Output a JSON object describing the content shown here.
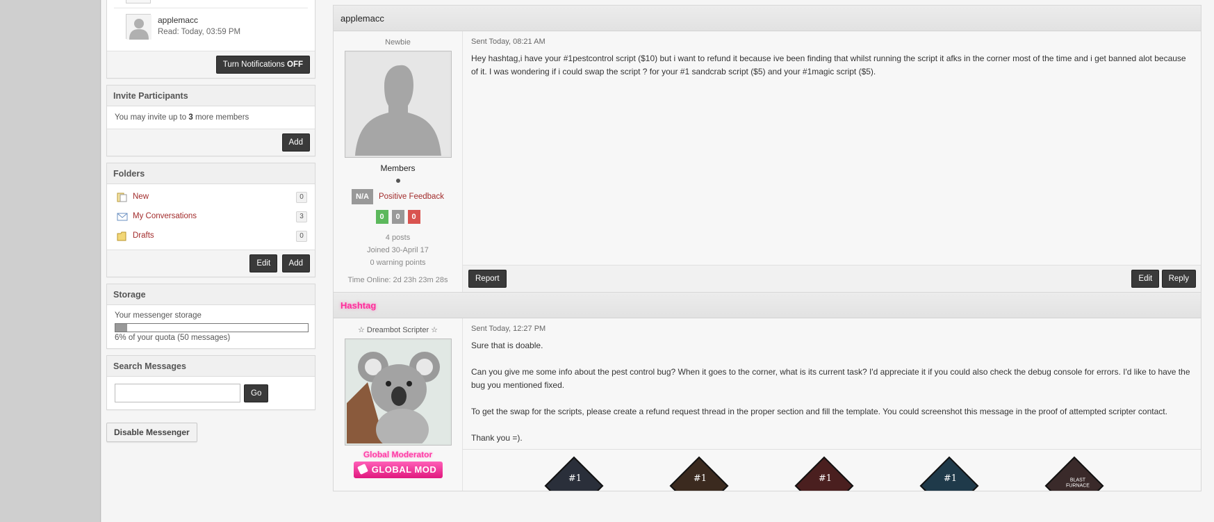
{
  "sidebar": {
    "participant": {
      "name": "applemacc",
      "read": "Read: Today, 03:59 PM"
    },
    "notifications_button": {
      "prefix": "Turn Notifications",
      "state": "OFF"
    },
    "invite": {
      "title": "Invite Participants",
      "text_before": "You may invite up to",
      "count": "3",
      "text_after": "more members",
      "add_label": "Add"
    },
    "folders": {
      "title": "Folders",
      "items": [
        {
          "label": "New",
          "count": "0",
          "icon": "new-folder-icon"
        },
        {
          "label": "My Conversations",
          "count": "3",
          "icon": "envelope-icon"
        },
        {
          "label": "Drafts",
          "count": "0",
          "icon": "folder-icon"
        }
      ],
      "edit_label": "Edit",
      "add_label": "Add"
    },
    "storage": {
      "title": "Storage",
      "label": "Your messenger storage",
      "percent": 6,
      "quota_text": "6% of your quota (50 messages)"
    },
    "search": {
      "title": "Search Messages",
      "go_label": "Go",
      "placeholder": ""
    },
    "disable_label": "Disable Messenger"
  },
  "posts": [
    {
      "author": "applemacc",
      "rank": "Newbie",
      "sent": "Sent Today, 08:21 AM",
      "message": "Hey hashtag,i have your #1pestcontrol script ($10) but i want to refund it because ive been finding that whilst running the script it afks in the corner most of the time and i get banned alot because of it. I was wondering if i could swap the script ? for your #1 sandcrab script ($5) and your #1magic script ($5).",
      "group": "Members",
      "feedback_na": "N/A",
      "feedback_label": "Positive Feedback",
      "feedback_counts": {
        "positive": "0",
        "neutral": "0",
        "negative": "0"
      },
      "posts_count": "4 posts",
      "joined": "Joined 30-April 17",
      "warnings": "0 warning points",
      "time_online": "Time Online: 2d 23h 23m 28s",
      "report_label": "Report",
      "edit_label": "Edit",
      "reply_label": "Reply"
    },
    {
      "author": "Hashtag",
      "rank": "☆ Dreambot Scripter ☆",
      "sent": "Sent Today, 12:27 PM",
      "paragraphs": [
        "Sure that is doable.",
        "Can you give me some info about the pest control bug? When it goes to the corner, what is its current task? I'd appreciate it if you could also check the debug console for errors. I'd like to have the bug you mentioned fixed.",
        "To get the swap for the scripts, please create a refund request thread in the proper section and fill the template. You could screenshot this message in the proof of attempted scripter contact.",
        "Thank you =)."
      ],
      "group": "Global Moderator",
      "badge": "GLOBAL MOD",
      "script_badges": [
        "#1",
        "#1",
        "#1",
        "#1",
        "BLAST FURNACE"
      ]
    }
  ],
  "colors": {
    "link_red": "#a22b2b",
    "mod_pink": "#ff2d9a",
    "fb_positive": "#5cb85c",
    "fb_neutral": "#999999",
    "fb_negative": "#d9534f"
  }
}
